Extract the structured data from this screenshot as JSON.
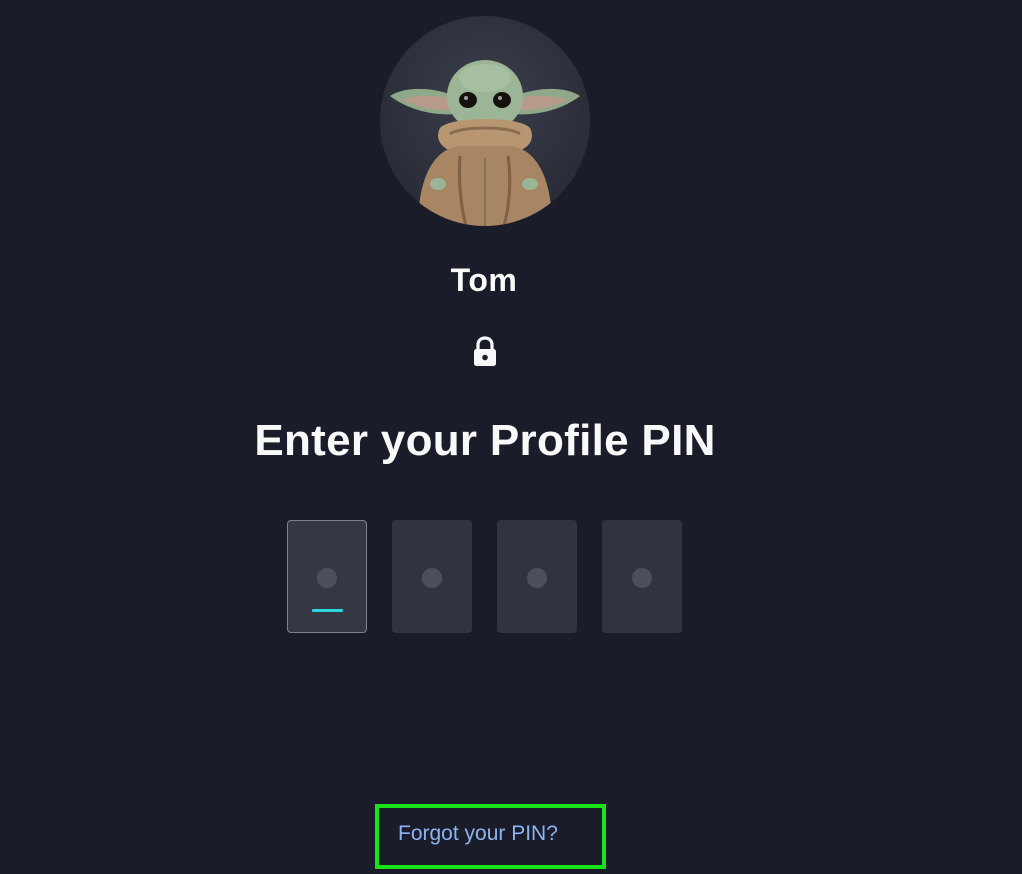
{
  "profile": {
    "name": "Tom",
    "avatar_icon": "grogu-avatar"
  },
  "lock": {
    "icon": "lock-icon"
  },
  "pin_prompt": {
    "heading": "Enter your Profile PIN",
    "digit_count": 4,
    "entered_digits": 0,
    "active_index": 0
  },
  "forgot": {
    "label": "Forgot your PIN?"
  },
  "colors": {
    "background": "#1a1c29",
    "pin_box": "#31343e",
    "cursor_accent": "#2cd5e0",
    "link": "#8cb4f0",
    "highlight_border": "#19e319"
  }
}
